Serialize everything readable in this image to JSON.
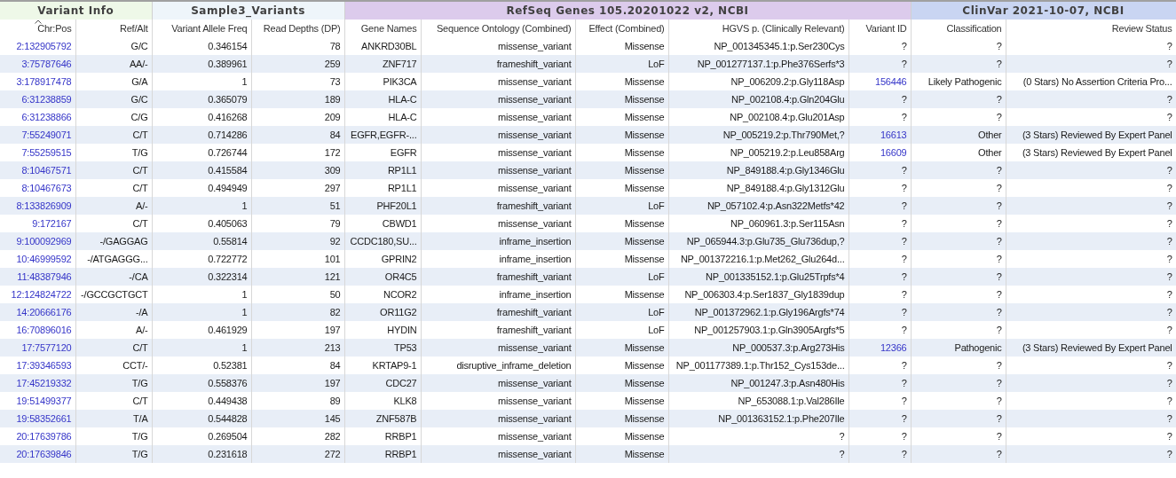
{
  "groups": [
    {
      "label": "Variant Info",
      "kind": "info"
    },
    {
      "label": "Sample3_Variants",
      "kind": "sample"
    },
    {
      "label": "RefSeq Genes 105.20201022 v2, NCBI",
      "kind": "refseq"
    },
    {
      "label": "ClinVar 2021-10-07, NCBI",
      "kind": "clinvar"
    }
  ],
  "columns": [
    {
      "label": "Chr:Pos",
      "sorted": true
    },
    {
      "label": "Ref/Alt",
      "sorted": false
    },
    {
      "label": "Variant Allele Freq",
      "sorted": false
    },
    {
      "label": "Read Depths (DP)",
      "sorted": false
    },
    {
      "label": "Gene Names",
      "sorted": false
    },
    {
      "label": "Sequence Ontology (Combined)",
      "sorted": false
    },
    {
      "label": "Effect (Combined)",
      "sorted": false
    },
    {
      "label": "HGVS p. (Clinically Relevant)",
      "sorted": false
    },
    {
      "label": "Variant ID",
      "sorted": false
    },
    {
      "label": "Classification",
      "sorted": false
    },
    {
      "label": "Review Status",
      "sorted": false
    }
  ],
  "rows": [
    [
      {
        "text": "2:132905792",
        "link": true
      },
      "G/C",
      "0.346154",
      "78",
      "ANKRD30BL",
      "missense_variant",
      "Missense",
      "NP_001345345.1:p.Ser230Cys",
      "?",
      "?",
      "?"
    ],
    [
      {
        "text": "3:75787646",
        "link": true
      },
      "AA/-",
      "0.389961",
      "259",
      "ZNF717",
      "frameshift_variant",
      "LoF",
      "NP_001277137.1:p.Phe376Serfs*3",
      "?",
      "?",
      "?"
    ],
    [
      {
        "text": "3:178917478",
        "link": true
      },
      "G/A",
      "1",
      "73",
      "PIK3CA",
      "missense_variant",
      "Missense",
      "NP_006209.2:p.Gly118Asp",
      {
        "text": "156446",
        "link": true
      },
      "Likely Pathogenic",
      "(0 Stars) No Assertion Criteria Pro..."
    ],
    [
      {
        "text": "6:31238859",
        "link": true
      },
      "G/C",
      "0.365079",
      "189",
      "HLA-C",
      "missense_variant",
      "Missense",
      "NP_002108.4:p.Gln204Glu",
      "?",
      "?",
      "?"
    ],
    [
      {
        "text": "6:31238866",
        "link": true
      },
      "C/G",
      "0.416268",
      "209",
      "HLA-C",
      "missense_variant",
      "Missense",
      "NP_002108.4:p.Glu201Asp",
      "?",
      "?",
      "?"
    ],
    [
      {
        "text": "7:55249071",
        "link": true
      },
      "C/T",
      "0.714286",
      "84",
      "EGFR,EGFR-...",
      "missense_variant",
      "Missense",
      "NP_005219.2:p.Thr790Met,?",
      {
        "text": "16613",
        "link": true
      },
      "Other",
      "(3 Stars) Reviewed By Expert Panel"
    ],
    [
      {
        "text": "7:55259515",
        "link": true
      },
      "T/G",
      "0.726744",
      "172",
      "EGFR",
      "missense_variant",
      "Missense",
      "NP_005219.2:p.Leu858Arg",
      {
        "text": "16609",
        "link": true
      },
      "Other",
      "(3 Stars) Reviewed By Expert Panel"
    ],
    [
      {
        "text": "8:10467571",
        "link": true
      },
      "C/T",
      "0.415584",
      "309",
      "RP1L1",
      "missense_variant",
      "Missense",
      "NP_849188.4:p.Gly1346Glu",
      "?",
      "?",
      "?"
    ],
    [
      {
        "text": "8:10467673",
        "link": true
      },
      "C/T",
      "0.494949",
      "297",
      "RP1L1",
      "missense_variant",
      "Missense",
      "NP_849188.4:p.Gly1312Glu",
      "?",
      "?",
      "?"
    ],
    [
      {
        "text": "8:133826909",
        "link": true
      },
      "A/-",
      "1",
      "51",
      "PHF20L1",
      "frameshift_variant",
      "LoF",
      "NP_057102.4:p.Asn322Metfs*42",
      "?",
      "?",
      "?"
    ],
    [
      {
        "text": "9:172167",
        "link": true
      },
      "C/T",
      "0.405063",
      "79",
      "CBWD1",
      "missense_variant",
      "Missense",
      "NP_060961.3:p.Ser115Asn",
      "?",
      "?",
      "?"
    ],
    [
      {
        "text": "9:100092969",
        "link": true
      },
      "-/GAGGAG",
      "0.55814",
      "92",
      "CCDC180,SU...",
      "inframe_insertion",
      "Missense",
      "NP_065944.3:p.Glu735_Glu736dup,?",
      "?",
      "?",
      "?"
    ],
    [
      {
        "text": "10:46999592",
        "link": true
      },
      "-/ATGAGGG...",
      "0.722772",
      "101",
      "GPRIN2",
      "inframe_insertion",
      "Missense",
      "NP_001372216.1:p.Met262_Glu264d...",
      "?",
      "?",
      "?"
    ],
    [
      {
        "text": "11:48387946",
        "link": true
      },
      "-/CA",
      "0.322314",
      "121",
      "OR4C5",
      "frameshift_variant",
      "LoF",
      "NP_001335152.1:p.Glu25Trpfs*4",
      "?",
      "?",
      "?"
    ],
    [
      {
        "text": "12:124824722",
        "link": true
      },
      "-/GCCGCTGCT",
      "1",
      "50",
      "NCOR2",
      "inframe_insertion",
      "Missense",
      "NP_006303.4:p.Ser1837_Gly1839dup",
      "?",
      "?",
      "?"
    ],
    [
      {
        "text": "14:20666176",
        "link": true
      },
      "-/A",
      "1",
      "82",
      "OR11G2",
      "frameshift_variant",
      "LoF",
      "NP_001372962.1:p.Gly196Argfs*74",
      "?",
      "?",
      "?"
    ],
    [
      {
        "text": "16:70896016",
        "link": true
      },
      "A/-",
      "0.461929",
      "197",
      "HYDIN",
      "frameshift_variant",
      "LoF",
      "NP_001257903.1:p.Gln3905Argfs*5",
      "?",
      "?",
      "?"
    ],
    [
      {
        "text": "17:7577120",
        "link": true
      },
      "C/T",
      "1",
      "213",
      "TP53",
      "missense_variant",
      "Missense",
      "NP_000537.3:p.Arg273His",
      {
        "text": "12366",
        "link": true
      },
      "Pathogenic",
      "(3 Stars) Reviewed By Expert Panel"
    ],
    [
      {
        "text": "17:39346593",
        "link": true
      },
      "CCT/-",
      "0.52381",
      "84",
      "KRTAP9-1",
      "disruptive_inframe_deletion",
      "Missense",
      "NP_001177389.1:p.Thr152_Cys153de...",
      "?",
      "?",
      "?"
    ],
    [
      {
        "text": "17:45219332",
        "link": true
      },
      "T/G",
      "0.558376",
      "197",
      "CDC27",
      "missense_variant",
      "Missense",
      "NP_001247.3:p.Asn480His",
      "?",
      "?",
      "?"
    ],
    [
      {
        "text": "19:51499377",
        "link": true
      },
      "C/T",
      "0.449438",
      "89",
      "KLK8",
      "missense_variant",
      "Missense",
      "NP_653088.1:p.Val286Ile",
      "?",
      "?",
      "?"
    ],
    [
      {
        "text": "19:58352661",
        "link": true
      },
      "T/A",
      "0.544828",
      "145",
      "ZNF587B",
      "missense_variant",
      "Missense",
      "NP_001363152.1:p.Phe207Ile",
      "?",
      "?",
      "?"
    ],
    [
      {
        "text": "20:17639786",
        "link": true
      },
      "T/G",
      "0.269504",
      "282",
      "RRBP1",
      "missense_variant",
      "Missense",
      "?",
      "?",
      "?",
      "?"
    ],
    [
      {
        "text": "20:17639846",
        "link": true
      },
      "T/G",
      "0.231618",
      "272",
      "RRBP1",
      "missense_variant",
      "Missense",
      "?",
      "?",
      "?",
      "?"
    ]
  ]
}
